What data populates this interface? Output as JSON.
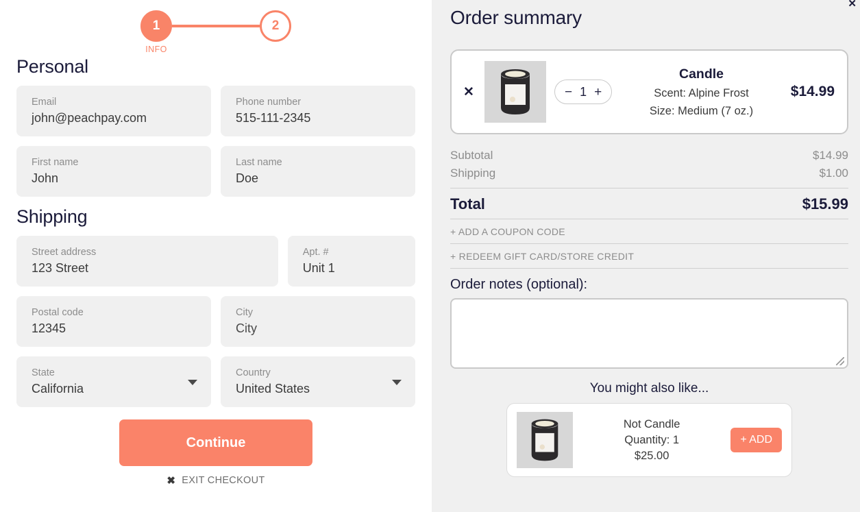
{
  "stepper": {
    "step1_number": "1",
    "step1_label": "INFO",
    "step2_number": "2",
    "accent_color": "#f98469"
  },
  "form": {
    "personal_title": "Personal",
    "shipping_title": "Shipping",
    "fields": {
      "email": {
        "label": "Email",
        "value": "john@peachpay.com"
      },
      "phone": {
        "label": "Phone number",
        "value": "515-111-2345"
      },
      "first_name": {
        "label": "First name",
        "value": "John"
      },
      "last_name": {
        "label": "Last name",
        "value": "Doe"
      },
      "street": {
        "label": "Street address",
        "value": "123 Street"
      },
      "apt": {
        "label": "Apt. #",
        "value": "Unit 1"
      },
      "postal": {
        "label": "Postal code",
        "value": "12345"
      },
      "city": {
        "label": "City",
        "value": "City"
      },
      "state": {
        "label": "State",
        "value": "California"
      },
      "country": {
        "label": "Country",
        "value": "United States"
      }
    },
    "continue_label": "Continue",
    "exit_label": "EXIT CHECKOUT",
    "exit_icon": "close-x-icon",
    "button_color": "#fa8369"
  },
  "summary": {
    "title": "Order summary",
    "item": {
      "remove_icon": "✕",
      "name": "Candle",
      "attr_1": "Scent: Alpine Frost",
      "attr_2": "Size: Medium (7 oz.)",
      "price": "$14.99",
      "qty_minus": "−",
      "qty_value": "1",
      "qty_plus": "+"
    },
    "totals": {
      "subtotal_label": "Subtotal",
      "subtotal_value": "$14.99",
      "shipping_label": "Shipping",
      "shipping_value": "$1.00",
      "total_label": "Total",
      "total_value": "$15.99"
    },
    "coupon_link": "+ ADD A COUPON CODE",
    "giftcard_link": "+ REDEEM GIFT CARD/STORE CREDIT",
    "notes_label": "Order notes (optional):",
    "notes_value": "",
    "notes_placeholder": "",
    "upsell_title": "You might also like...",
    "upsell_item": {
      "name": "Not Candle",
      "quantity": "Quantity: 1",
      "price": "$25.00",
      "add_label": "+ ADD"
    },
    "corner_mark": "✕"
  }
}
